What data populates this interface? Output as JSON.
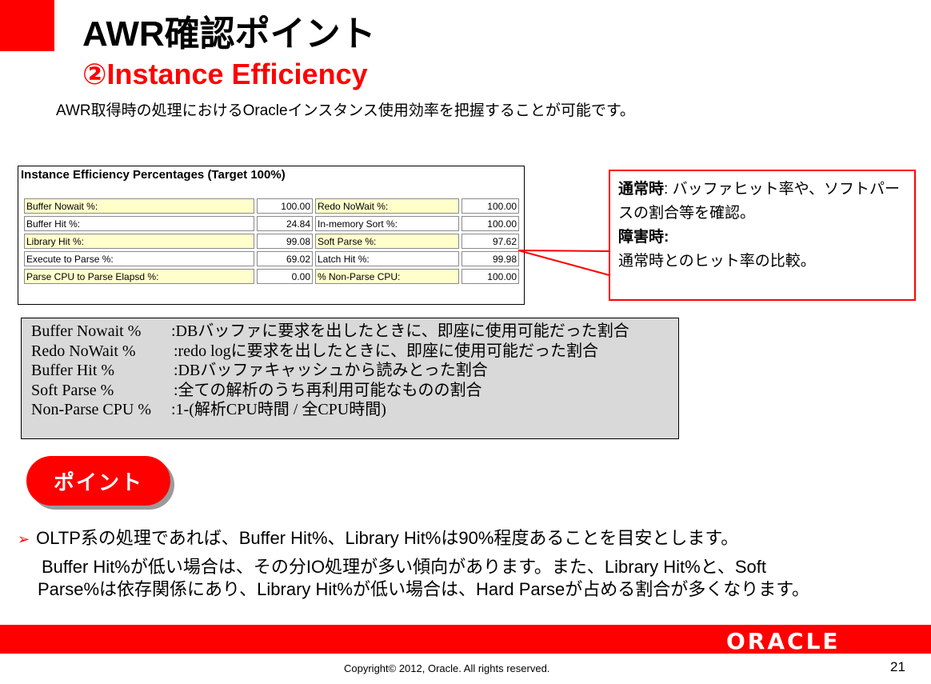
{
  "header": {
    "title": "AWR確認ポイント",
    "subtitle": "②Instance Efficiency",
    "description": "AWR取得時の処理におけるOracleインスタンス使用効率を把握することが可能です。"
  },
  "efficiency": {
    "title": "Instance Efficiency Percentages (Target 100%)",
    "rows": [
      {
        "l1": "Buffer Nowait %:",
        "v1": "100.00",
        "l2": "Redo NoWait %:",
        "v2": "100.00"
      },
      {
        "l1": "Buffer Hit %:",
        "v1": "24.84",
        "l2": "In-memory Sort %:",
        "v2": "100.00"
      },
      {
        "l1": "Library Hit %:",
        "v1": "99.08",
        "l2": "Soft Parse %:",
        "v2": "97.62"
      },
      {
        "l1": "Execute to Parse %:",
        "v1": "69.02",
        "l2": "Latch Hit %:",
        "v2": "99.98"
      },
      {
        "l1": "Parse CPU to Parse Elapsd %:",
        "v1": "0.00",
        "l2": "% Non-Parse CPU:",
        "v2": "100.00"
      }
    ]
  },
  "callout": {
    "normal_key": "通常時",
    "normal_text": ": バッファヒット率や、ソフトパースの割合等を確認。",
    "fault_key": "障害時",
    "fault_colon": ":",
    "fault_text": "通常時とのヒット率の比較。"
  },
  "definitions": [
    {
      "term": "Buffer Nowait %",
      "desc": ":DBバッファに要求を出したときに、即座に使用可能だった割合"
    },
    {
      "term": "Redo NoWait %",
      "desc": ":redo logに要求を出したときに、即座に使用可能だった割合"
    },
    {
      "term": "Buffer Hit %",
      "desc": ":DBバッファキャッシュから読みとった割合"
    },
    {
      "term": "Soft Parse %",
      "desc": ":全ての解析のうち再利用可能なものの割合"
    },
    {
      "term": "Non-Parse CPU %",
      "desc": ":1-(解析CPU時間 / 全CPU時間)"
    }
  ],
  "point": {
    "label": "ポイント",
    "line1": "OLTP系の処理であれば、Buffer Hit%、Library Hit%は90%程度あることを目安とします。",
    "line2": "Buffer Hit%が低い場合は、その分IO処理が多い傾向があります。また、Library Hit%と、Soft",
    "line3": "Parse%は依存関係にあり、Library Hit%が低い場合は、Hard Parseが占める割合が多くなります。"
  },
  "footer": {
    "logo": "ORACLE",
    "copyright": "Copyright© 2012, Oracle. All rights reserved.",
    "page": "21"
  },
  "colors": {
    "accent": "#ff0000",
    "highlight": "#ffffcc",
    "definition_bg": "#d9d9d9"
  },
  "icons": {
    "bullet": "arrow-bullet-icon"
  }
}
